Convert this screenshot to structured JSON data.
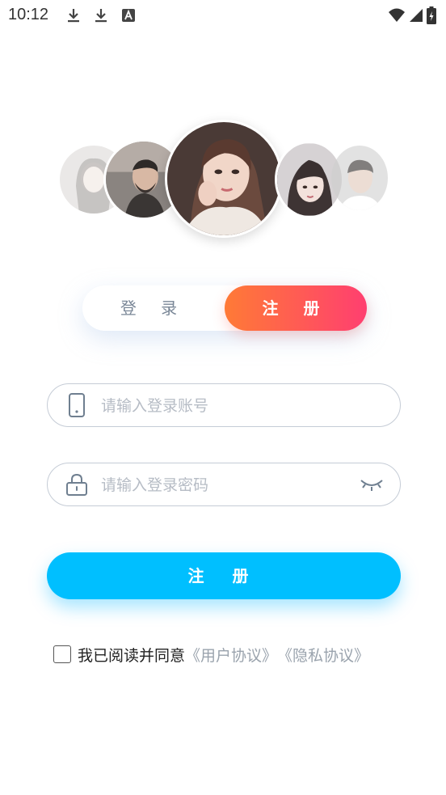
{
  "status_bar": {
    "time": "10:12",
    "icons_left": [
      "download-icon",
      "download-icon",
      "text-a-icon"
    ],
    "icons_right": [
      "wifi-icon",
      "signal-icon",
      "battery-charging-icon"
    ]
  },
  "avatars": [
    "avatar-woman-faded",
    "avatar-man-beard",
    "avatar-woman-center",
    "avatar-woman-bangs",
    "avatar-man-faded"
  ],
  "tabs": {
    "login_label": "登 录",
    "register_label": "注 册",
    "active": "register"
  },
  "form": {
    "account_placeholder": "请输入登录账号",
    "account_value": "",
    "password_placeholder": "请输入登录密码",
    "password_value": "",
    "submit_label": "注 册"
  },
  "agreement": {
    "text": "我已阅读并同意",
    "user_agreement": "《用户协议》",
    "privacy_agreement": "《隐私协议》",
    "checked": false
  },
  "colors": {
    "tab_gradient_start": "#ff7a36",
    "tab_gradient_end": "#ff3f70",
    "submit_bg": "#00bfff",
    "input_border": "#c5ccd6",
    "placeholder": "#b6bcc5"
  }
}
